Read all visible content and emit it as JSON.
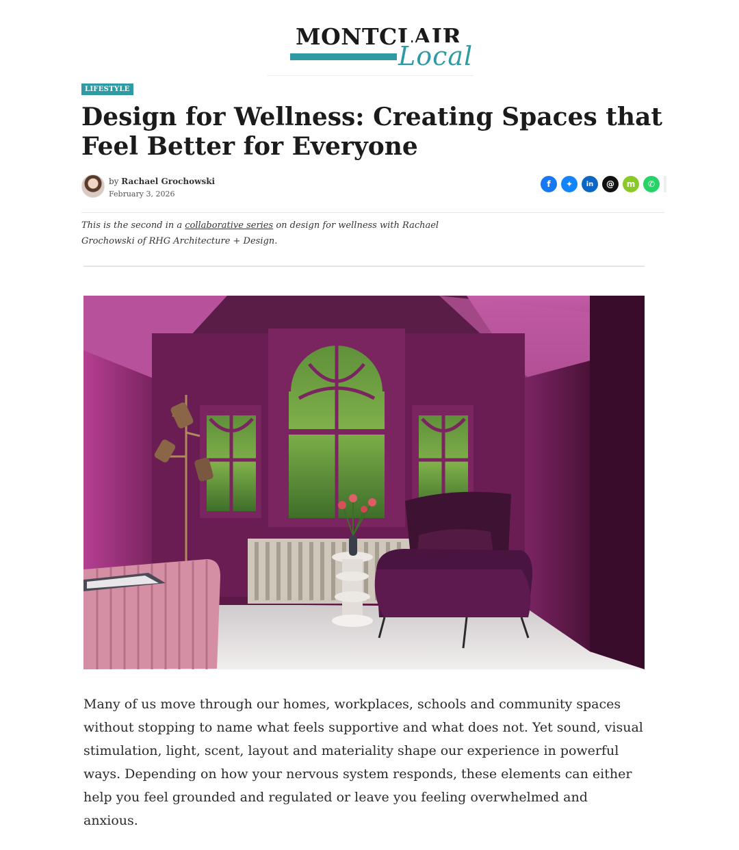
{
  "site": {
    "logo_word": "MONTCLAIR",
    "logo_script": "Local",
    "brand_color": "#2e9aa4"
  },
  "article": {
    "category": "LIFESTYLE",
    "headline": "Design for Wellness: Creating Spaces that Feel Better for Everyone",
    "byline_prefix": "by",
    "author": "Rachael Grochowski",
    "date": "February 3, 2026",
    "intro_before": "This is the second in a ",
    "intro_link": "collaborative series",
    "intro_after": " on design for wellness with Rachael Grochowski of RHG Architecture + Design.",
    "body": "Many of us move through our homes, workplaces, schools and community spaces without stopping to name what feels supportive and what does not. Yet sound, visual stimulation, light, scent, layout and materiality shape our experience in powerful ways. Depending on how your nervous system responds, these elements can either help you feel grounded and regulated or leave you feeling overwhelmed and anxious."
  },
  "share": [
    {
      "icon": "facebook-icon",
      "glyph": "f",
      "color": "#1877f2"
    },
    {
      "icon": "bluesky-icon",
      "glyph": "✦",
      "color": "#1185fe"
    },
    {
      "icon": "linkedin-icon",
      "glyph": "in",
      "color": "#0a66c2"
    },
    {
      "icon": "threads-icon",
      "glyph": "@",
      "color": "#111111"
    },
    {
      "icon": "smore-icon",
      "glyph": "m",
      "color": "#8bc926"
    },
    {
      "icon": "whatsapp-icon",
      "glyph": "✆",
      "color": "#25d366"
    }
  ]
}
